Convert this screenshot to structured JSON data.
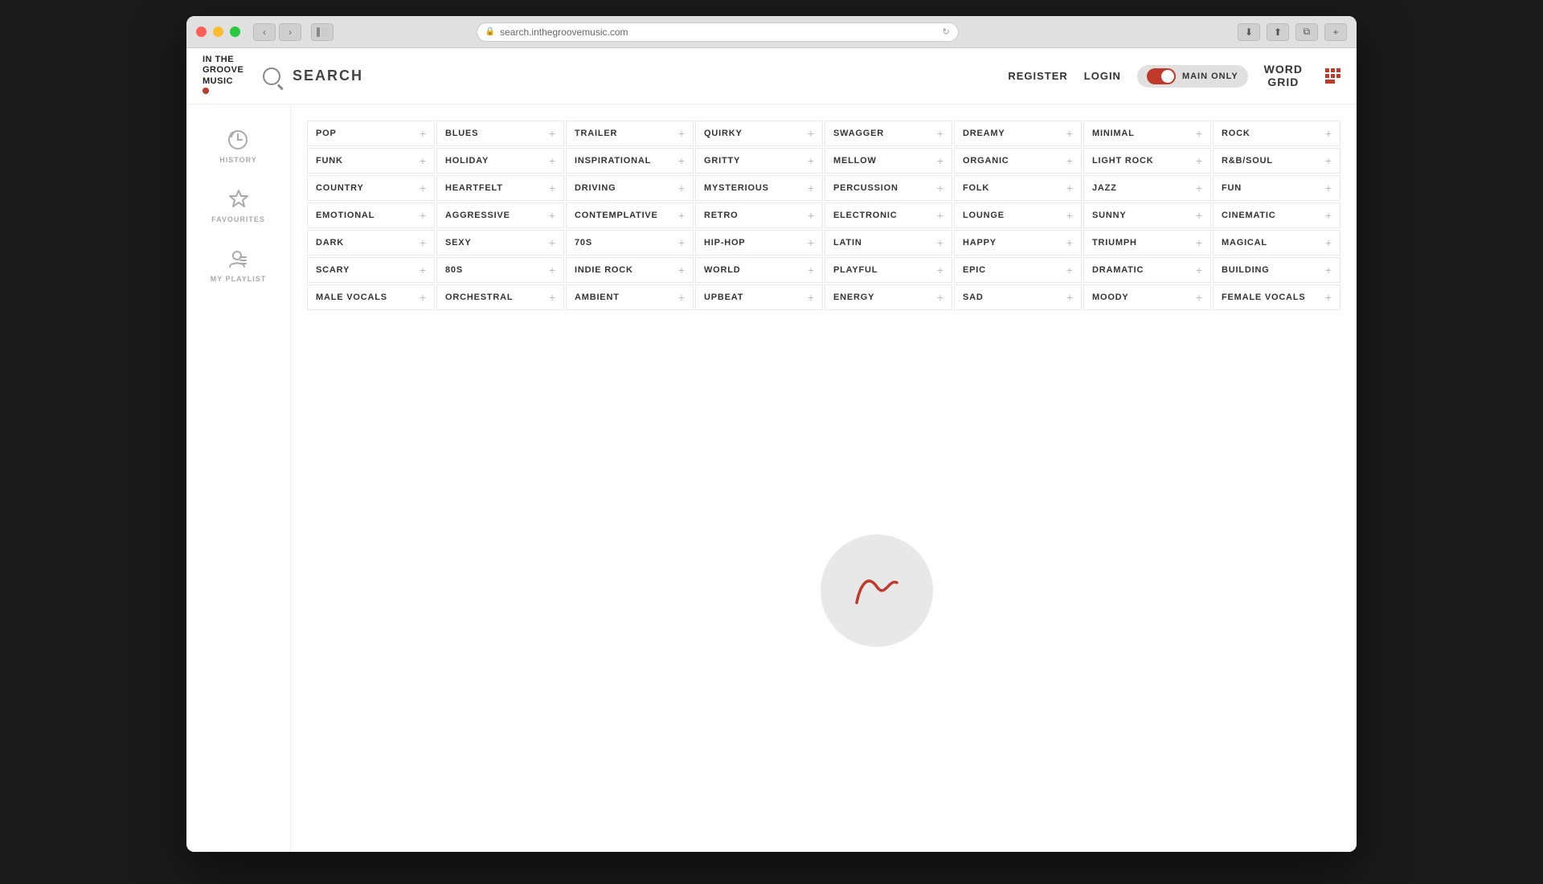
{
  "window": {
    "url": "search.inthegroovemusic.com"
  },
  "header": {
    "logo_line1": "IN THE",
    "logo_line2": "GROOVE",
    "logo_line3": "MUSIC",
    "search_label": "SEARCH",
    "register_label": "REGISTER",
    "login_label": "LOGIN",
    "main_only_label": "MAIN ONLY",
    "word_grid_line1": "WORD",
    "word_grid_line2": "GRID"
  },
  "sidebar": {
    "items": [
      {
        "id": "history",
        "label": "HISTORY",
        "icon": "⟳"
      },
      {
        "id": "favourites",
        "label": "FAVOURITES",
        "icon": "★"
      },
      {
        "id": "playlist",
        "label": "MY PLAYLIST",
        "icon": "👤"
      }
    ]
  },
  "tags": {
    "col1": [
      {
        "label": "POP"
      },
      {
        "label": "ROCK"
      },
      {
        "label": "LIGHT ROCK"
      },
      {
        "label": "FOLK"
      },
      {
        "label": "ELECTRONIC"
      },
      {
        "label": "HIP-HOP"
      },
      {
        "label": "INDIE ROCK"
      },
      {
        "label": "ORCHESTRAL"
      }
    ],
    "col2": [
      {
        "label": "BLUES"
      },
      {
        "label": "FUNK"
      },
      {
        "label": "R&B/SOUL"
      },
      {
        "label": "JAZZ"
      },
      {
        "label": "LOUNGE"
      },
      {
        "label": "LATIN"
      },
      {
        "label": "WORLD"
      },
      {
        "label": "AMBIENT"
      }
    ],
    "col3": [
      {
        "label": "TRAILER"
      },
      {
        "label": "HOLIDAY"
      },
      {
        "label": "COUNTRY"
      },
      {
        "label": "FUN"
      },
      {
        "label": "SUNNY"
      },
      {
        "label": "HAPPY"
      },
      {
        "label": "PLAYFUL"
      },
      {
        "label": "UPBEAT"
      }
    ],
    "col4": [
      {
        "label": "QUIRKY"
      },
      {
        "label": "INSPIRATIONAL"
      },
      {
        "label": "HEARTFELT"
      },
      {
        "label": "EMOTIONAL"
      },
      {
        "label": "CINEMATIC"
      },
      {
        "label": "TRIUMPH"
      },
      {
        "label": "EPIC"
      },
      {
        "label": "ENERGY"
      }
    ],
    "col5": [
      {
        "label": "SWAGGER"
      },
      {
        "label": "GRITTY"
      },
      {
        "label": "DRIVING"
      },
      {
        "label": "AGGRESSIVE"
      },
      {
        "label": "DARK"
      },
      {
        "label": "MAGICAL"
      },
      {
        "label": "DRAMATIC"
      },
      {
        "label": "SAD"
      }
    ],
    "col6": [
      {
        "label": "DREAMY"
      },
      {
        "label": "MELLOW"
      },
      {
        "label": "MYSTERIOUS"
      },
      {
        "label": "CONTEMPLATIVE"
      },
      {
        "label": "SEXY"
      },
      {
        "label": "SCARY"
      },
      {
        "label": "BUILDING"
      },
      {
        "label": "MOODY"
      }
    ],
    "col7": [
      {
        "label": "MINIMAL"
      },
      {
        "label": "ORGANIC"
      },
      {
        "label": "PERCUSSION"
      },
      {
        "label": "RETRO"
      },
      {
        "label": "70S"
      },
      {
        "label": "80S"
      },
      {
        "label": "MALE VOCALS"
      },
      {
        "label": "FEMALE VOCALS"
      }
    ]
  },
  "plus_symbol": "+"
}
